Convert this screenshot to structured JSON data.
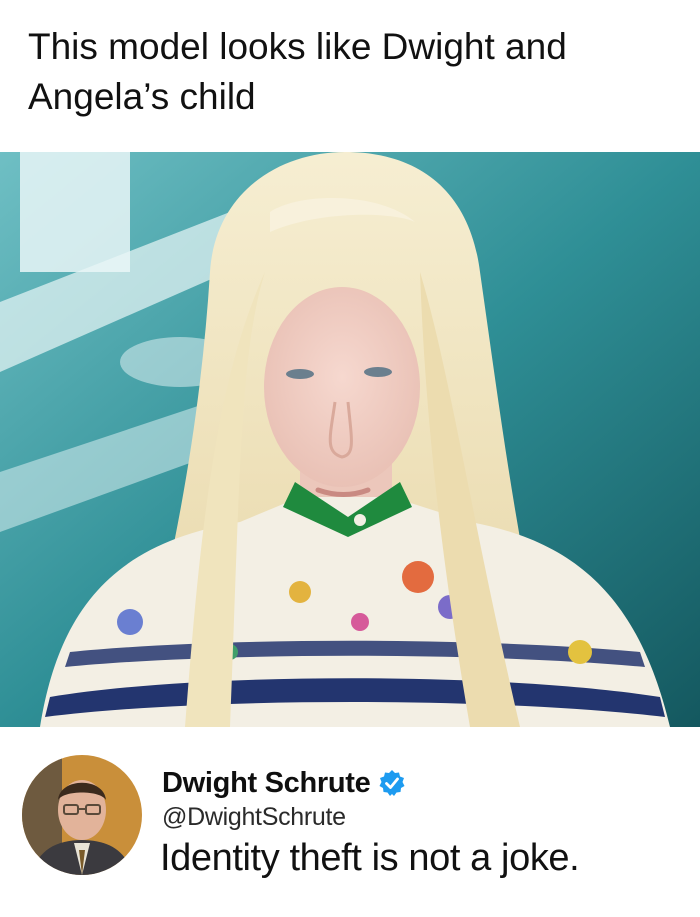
{
  "meme": {
    "caption": "This model looks like Dwight and Angela’s child"
  },
  "photo": {
    "subject": "model-photo"
  },
  "tweet": {
    "display_name": "Dwight Schrute",
    "handle": "@DwightSchrute",
    "text": "Identity theft is not a joke.",
    "verified_color": "#1d9bf0"
  },
  "colors": {
    "backdrop": "#2a8c93",
    "hair": "#f1e6c4",
    "collar": "#1f8a3e"
  }
}
